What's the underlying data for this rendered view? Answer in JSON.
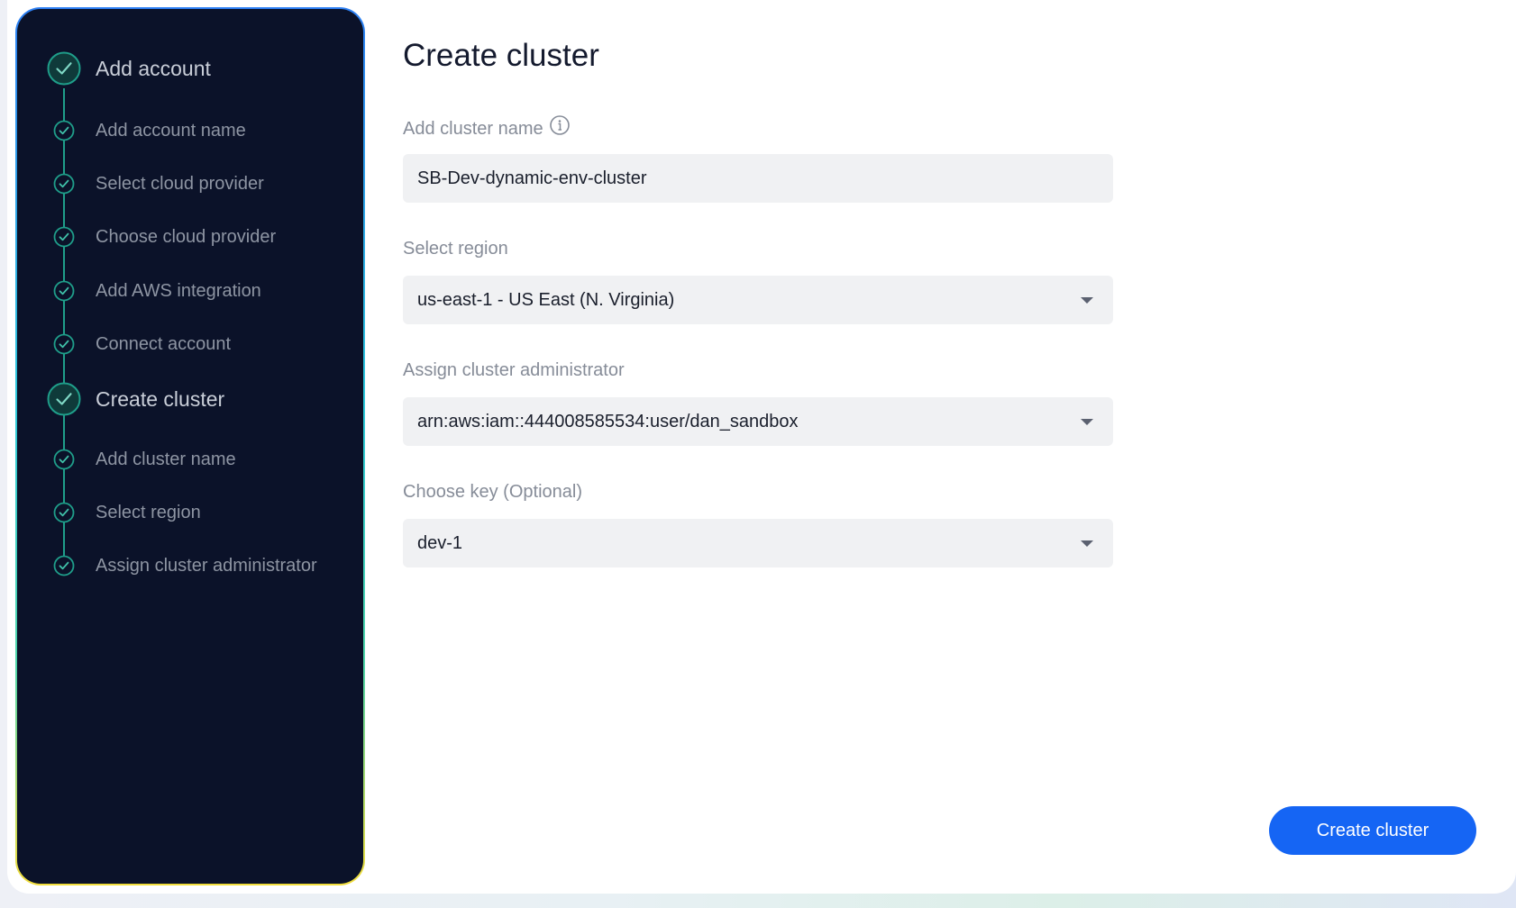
{
  "sidebar": {
    "steps": [
      {
        "label": "Add account",
        "kind": "major",
        "status": "done"
      },
      {
        "label": "Add account name",
        "kind": "minor",
        "status": "done"
      },
      {
        "label": "Select cloud provider",
        "kind": "minor",
        "status": "done"
      },
      {
        "label": "Choose cloud provider",
        "kind": "minor",
        "status": "done"
      },
      {
        "label": "Add AWS integration",
        "kind": "minor",
        "status": "done"
      },
      {
        "label": "Connect account",
        "kind": "minor",
        "status": "done"
      },
      {
        "label": "Create cluster",
        "kind": "major",
        "status": "done"
      },
      {
        "label": "Add cluster name",
        "kind": "minor",
        "status": "done"
      },
      {
        "label": "Select region",
        "kind": "minor",
        "status": "done"
      },
      {
        "label": "Assign cluster administrator",
        "kind": "minor",
        "status": "done"
      }
    ],
    "icon": "check-circle-icon"
  },
  "main": {
    "title": "Create cluster",
    "cluster_name": {
      "label": "Add cluster name",
      "value": "SB-Dev-dynamic-env-cluster",
      "help_icon": "info-icon"
    },
    "region": {
      "label": "Select region",
      "value": "us-east-1 - US East (N. Virginia)"
    },
    "administrator": {
      "label": "Assign cluster administrator",
      "value": "arn:aws:iam::444008585534:user/dan_sandbox"
    },
    "key": {
      "label": "Choose key (Optional)",
      "value": "dev-1"
    },
    "submit_label": "Create cluster"
  },
  "colors": {
    "sidebar_bg": "#0b1229",
    "check_accent": "#1f9e8a",
    "primary": "#1565f4"
  }
}
